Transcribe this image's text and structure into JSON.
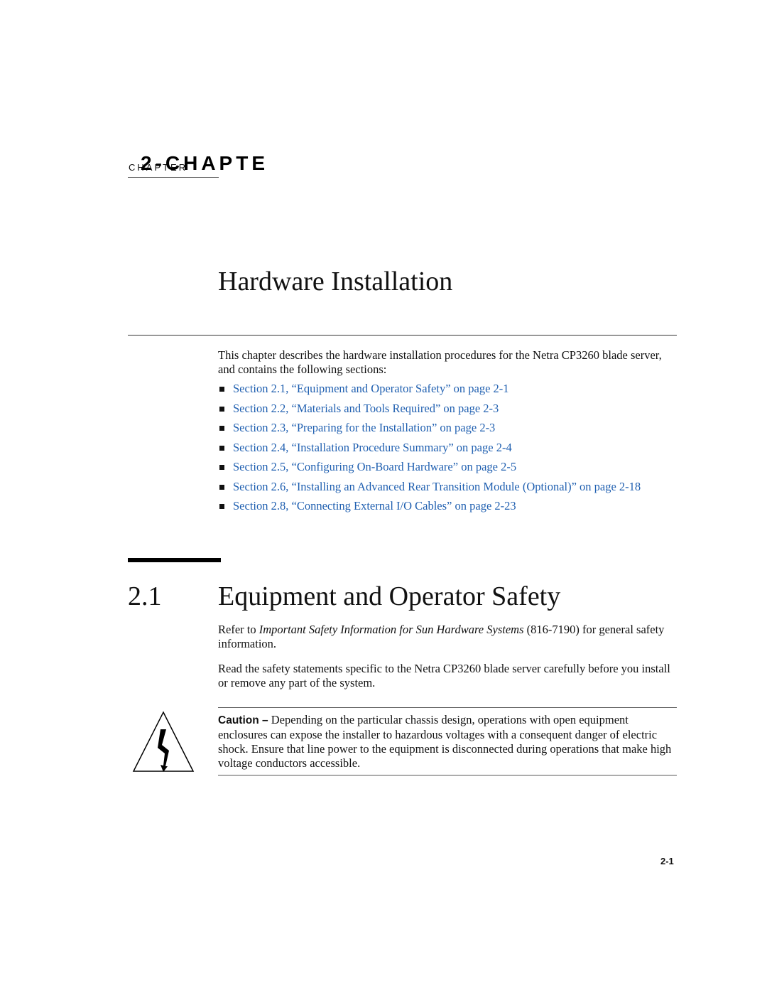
{
  "chapter": {
    "label_small": "CHAPTER",
    "label_big": "2-CHAPTE",
    "title": "Hardware Installation"
  },
  "intro": "This chapter describes the hardware installation procedures for the Netra CP3260 blade server, and contains the following sections:",
  "toc": [
    {
      "text": "Section 2.1, “Equipment and Operator Safety” on page 2-1"
    },
    {
      "text": "Section 2.2, “Materials and Tools Required” on page 2-3"
    },
    {
      "text": "Section 2.3, “Preparing for the Installation” on page 2-3"
    },
    {
      "text": "Section 2.4, “Installation Procedure Summary” on page 2-4"
    },
    {
      "text": "Section 2.5, “Configuring On-Board Hardware” on page 2-5"
    },
    {
      "text": "Section 2.6, “Installing an Advanced Rear Transition Module (Optional)” on page 2-18"
    },
    {
      "text": "Section 2.8, “Connecting External I/O Cables” on page 2-23"
    }
  ],
  "section": {
    "number": "2.1",
    "title": "Equipment and Operator Safety",
    "p1_prefix": "Refer to ",
    "p1_italic": "Important Safety Information for Sun Hardware Systems",
    "p1_suffix": " (816-7190) for general safety information.",
    "p2": "Read the safety statements specific to the Netra CP3260 blade server carefully before you install or remove any part of the system."
  },
  "caution": {
    "icon": "electrical-hazard-icon",
    "label": "Caution –",
    "text": " Depending on the particular chassis design, operations with open equipment enclosures can expose the installer to hazardous voltages with a consequent danger of electric shock. Ensure that line power to the equipment is disconnected during operations that make high voltage conductors accessible."
  },
  "page_number": "2-1",
  "colors": {
    "link": "#1f5fb0"
  }
}
